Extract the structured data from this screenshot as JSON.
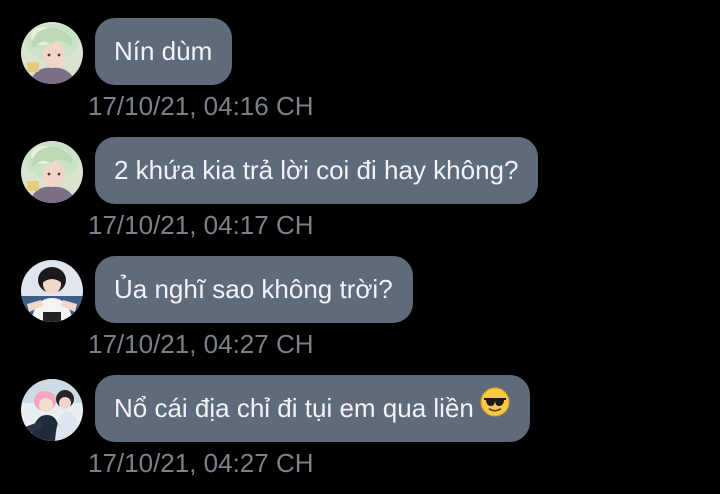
{
  "messages": [
    {
      "text": "Nín dùm",
      "time": "17/10/21, 04:16 CH",
      "avatar": "avatar-pastel-hair",
      "emoji": ""
    },
    {
      "text": "2 khứa kia trả lời coi đi hay không?",
      "time": "17/10/21, 04:17 CH",
      "avatar": "avatar-pastel-hair",
      "emoji": ""
    },
    {
      "text": "Ủa nghĩ sao không trời?",
      "time": "17/10/21, 04:27 CH",
      "avatar": "avatar-dark-hair",
      "emoji": ""
    },
    {
      "text": "Nổ cái địa chỉ đi tụi em qua liền",
      "time": "17/10/21, 04:27 CH",
      "avatar": "avatar-pink-hair",
      "emoji": "sunglasses-emoji-icon"
    }
  ],
  "colors": {
    "background": "#000000",
    "bubble": "#5f6b7b",
    "bubble_text": "#f1f3f6",
    "timestamp": "#7b818a"
  }
}
